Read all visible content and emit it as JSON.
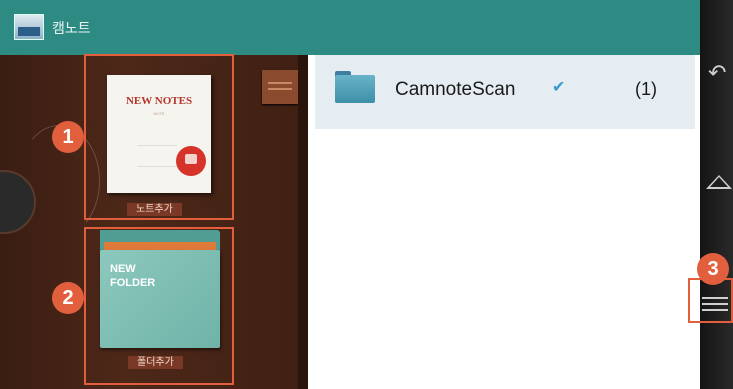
{
  "appbar": {
    "title": "캠노트",
    "icon": "app-logo-icon"
  },
  "shelf": {
    "new_notes": {
      "title": "NEW NOTES",
      "subtitle": "NOTE",
      "tag": "노트추가",
      "icon": "new-notes-icon"
    },
    "new_folder": {
      "title_line1": "NEW",
      "title_line2": "FOLDER",
      "tag": "폴더추가",
      "icon": "new-folder-icon"
    }
  },
  "list": {
    "rows": [
      {
        "name": "CamnoteScan",
        "count": "(1)",
        "icon": "folder-icon",
        "checked": true
      }
    ]
  },
  "callouts": {
    "one": "1",
    "two": "2",
    "three": "3"
  },
  "colors": {
    "appbar": "#2e8b84",
    "highlight": "#e25f3e",
    "shelf": "#4d2819",
    "row": "#e5edf2"
  }
}
